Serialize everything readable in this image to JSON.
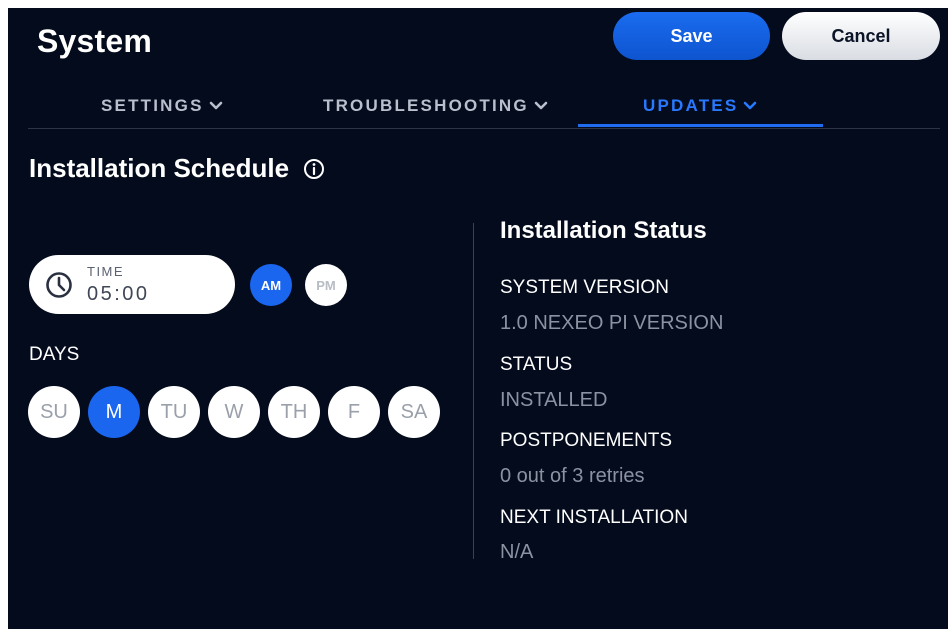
{
  "header": {
    "title": "System",
    "save_label": "Save",
    "cancel_label": "Cancel"
  },
  "tabs": [
    {
      "label": "SETTINGS"
    },
    {
      "label": "TROUBLESHOOTING"
    },
    {
      "label": "UPDATES",
      "active": true
    }
  ],
  "schedule": {
    "title": "Installation Schedule",
    "info_icon": "info-circle-icon",
    "time": {
      "icon": "clock-icon",
      "label": "TIME",
      "value": "05:00"
    },
    "am_label": "AM",
    "pm_label": "PM",
    "selected_period": "AM",
    "days_label": "DAYS",
    "days": [
      {
        "label": "SU",
        "selected": false
      },
      {
        "label": "M",
        "selected": true
      },
      {
        "label": "TU",
        "selected": false
      },
      {
        "label": "W",
        "selected": false
      },
      {
        "label": "TH",
        "selected": false
      },
      {
        "label": "F",
        "selected": false
      },
      {
        "label": "SA",
        "selected": false
      }
    ]
  },
  "status": {
    "title": "Installation Status",
    "system_version_label": "SYSTEM VERSION",
    "system_version_value": "1.0 NEXEO PI VERSION",
    "status_label": "STATUS",
    "status_value": "INSTALLED",
    "postponements_label": "POSTPONEMENTS",
    "postponements_value": "0 out of 3 retries",
    "next_installation_label": "NEXT INSTALLATION",
    "next_installation_value": "N/A"
  },
  "colors": {
    "background": "#040b1c",
    "accent": "#1a66ef",
    "active_tab": "#2979ff",
    "muted_text": "#8b93a3"
  }
}
